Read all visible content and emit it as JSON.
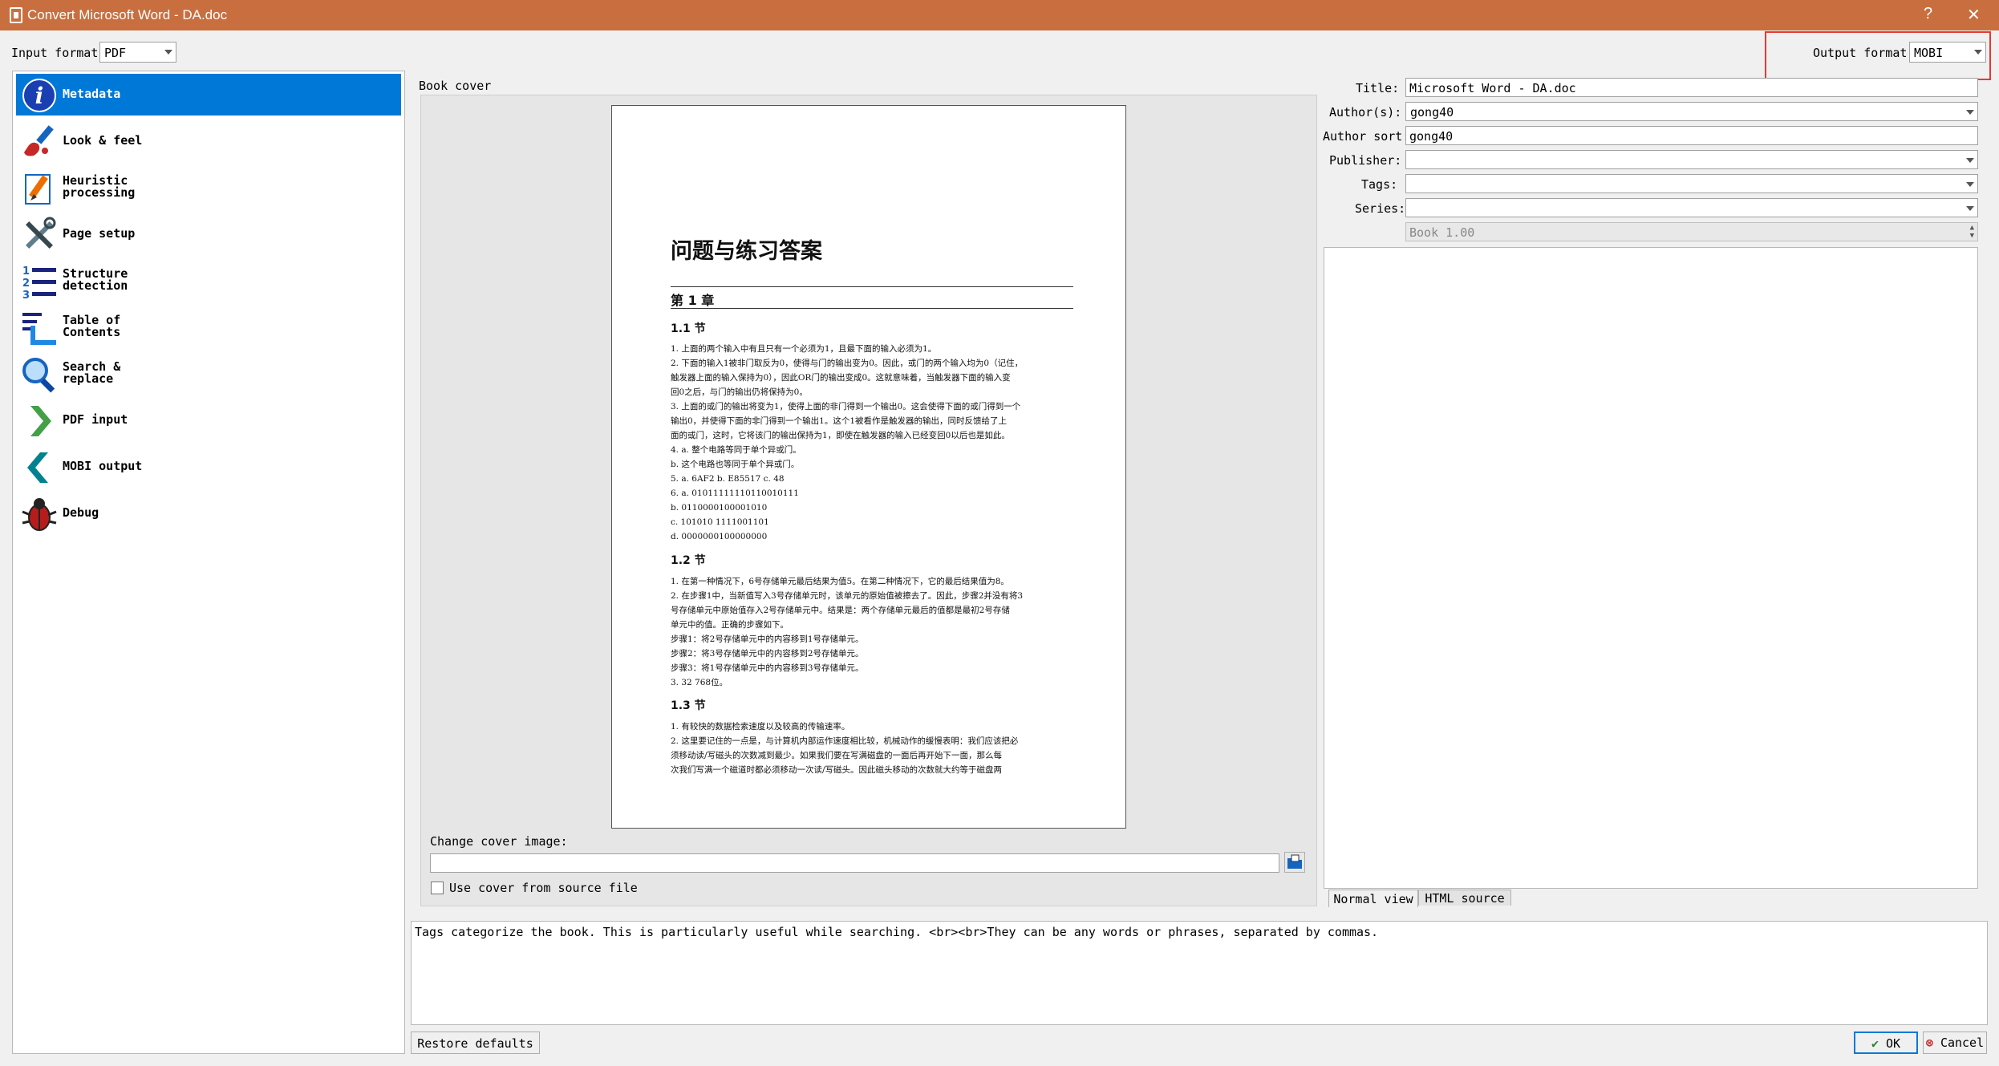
{
  "window": {
    "title": "Convert Microsoft Word - DA.doc",
    "help_glyph": "?",
    "close_glyph": "✕"
  },
  "input_format": {
    "label": "Input format:",
    "value": "PDF"
  },
  "output_format": {
    "label": "Output format:",
    "value": "MOBI"
  },
  "sidebar": {
    "items": [
      {
        "label_1": "Metadata",
        "label_2": "",
        "icon": "info-icon"
      },
      {
        "label_1": "Look & feel",
        "label_2": "",
        "icon": "paintbrush-icon"
      },
      {
        "label_1": "Heuristic",
        "label_2": "processing",
        "icon": "pencil-icon"
      },
      {
        "label_1": "Page setup",
        "label_2": "",
        "icon": "tools-icon"
      },
      {
        "label_1": "Structure",
        "label_2": "detection",
        "icon": "numbered-list-icon"
      },
      {
        "label_1": "Table of",
        "label_2": "Contents",
        "icon": "toc-icon"
      },
      {
        "label_1": "Search &",
        "label_2": "replace",
        "icon": "magnifier-icon"
      },
      {
        "label_1": "PDF input",
        "label_2": "",
        "icon": "chevron-right-icon"
      },
      {
        "label_1": "MOBI output",
        "label_2": "",
        "icon": "chevron-left-icon"
      },
      {
        "label_1": "Debug",
        "label_2": "",
        "icon": "bug-icon"
      }
    ]
  },
  "cover": {
    "label": "Book cover",
    "change_label": "Change cover image:",
    "path_value": "",
    "use_source_label": "Use cover from source file",
    "page": {
      "title": "问题与练习答案",
      "chapter": "第 1 章",
      "s1": "1.1 节",
      "s2": "1.2 节",
      "s3": "1.3 节",
      "lines1": [
        "1.  上面的两个输入中有且只有一个必须为1，且最下面的输入必须为1。",
        "2.  下面的输入1被非门取反为0，使得与门的输出变为0。因此，或门的两个输入均为0（记住，",
        "     触发器上面的输入保持为0），因此OR门的输出变成0。这就意味着，当触发器下面的输入变",
        "     回0之后，与门的输出仍将保持为0。",
        "3.  上面的或门的输出将变为1，使得上面的非门得到一个输出0。这会使得下面的或门得到一个",
        "     输出0，并使得下面的非门得到一个输出1。这个1被看作是触发器的输出，同时反馈给了上",
        "     面的或门，这时，它将该门的输出保持为1，即使在触发器的输入已经变回0以后也是如此。",
        "4.  a. 整个电路等同于单个异或门。",
        "     b. 这个电路也等同于单个异或门。",
        "5.  a. 6AF2       b. E85517       c. 48",
        "6.  a. 01011111110110010111",
        "     b. 0110000100001010",
        "     c. 101010 1111001101",
        "     d. 0000000100000000"
      ],
      "lines2": [
        "1.  在第一种情况下，6号存储单元最后结果为值5。在第二种情况下，它的最后结果值为8。",
        "2.  在步骤1中，当新值写入3号存储单元时，该单元的原始值被擦去了。因此，步骤2并没有将3",
        "     号存储单元中原始值存入2号存储单元中。结果是：两个存储单元最后的值都是最初2号存储",
        "     单元中的值。正确的步骤如下。",
        "     步骤1：将2号存储单元中的内容移到1号存储单元。",
        "     步骤2：将3号存储单元中的内容移到2号存储单元。",
        "     步骤3：将1号存储单元中的内容移到3号存储单元。",
        "3.  32 768位。"
      ],
      "lines3": [
        "1.  有较快的数据检索速度以及较高的传输速率。",
        "2.  这里要记住的一点是，与计算机内部运作速度相比较，机械动作的缓慢表明：我们应该把必",
        "     须移动读/写磁头的次数减到最少。如果我们要在写满磁盘的一面后再开始下一面，那么每",
        "     次我们写满一个磁道时都必须移动一次读/写磁头。因此磁头移动的次数就大约等于磁盘两"
      ]
    }
  },
  "metadata": {
    "title_label": "Title:",
    "title_value": "Microsoft Word - DA.doc",
    "authors_label": "Author(s):",
    "authors_value": "gong40",
    "author_sort_label": "Author sort:",
    "author_sort_value": "gong40",
    "publisher_label": "Publisher:",
    "publisher_value": "",
    "tags_label": "Tags:",
    "tags_value": "",
    "series_label": "Series:",
    "series_value": "",
    "series_index": "Book 1.00",
    "comments_value": ""
  },
  "tabs": {
    "normal": "Normal view",
    "html": "HTML source"
  },
  "help_text": "Tags categorize the book. This is particularly useful while searching. <br><br>They can be any words or phrases, separated by commas.",
  "buttons": {
    "restore": "Restore defaults",
    "ok": "OK",
    "cancel": "Cancel"
  },
  "colors": {
    "titlebar": "#c96f3f",
    "selection": "#0078d7",
    "highlight_box": "#e53935"
  }
}
